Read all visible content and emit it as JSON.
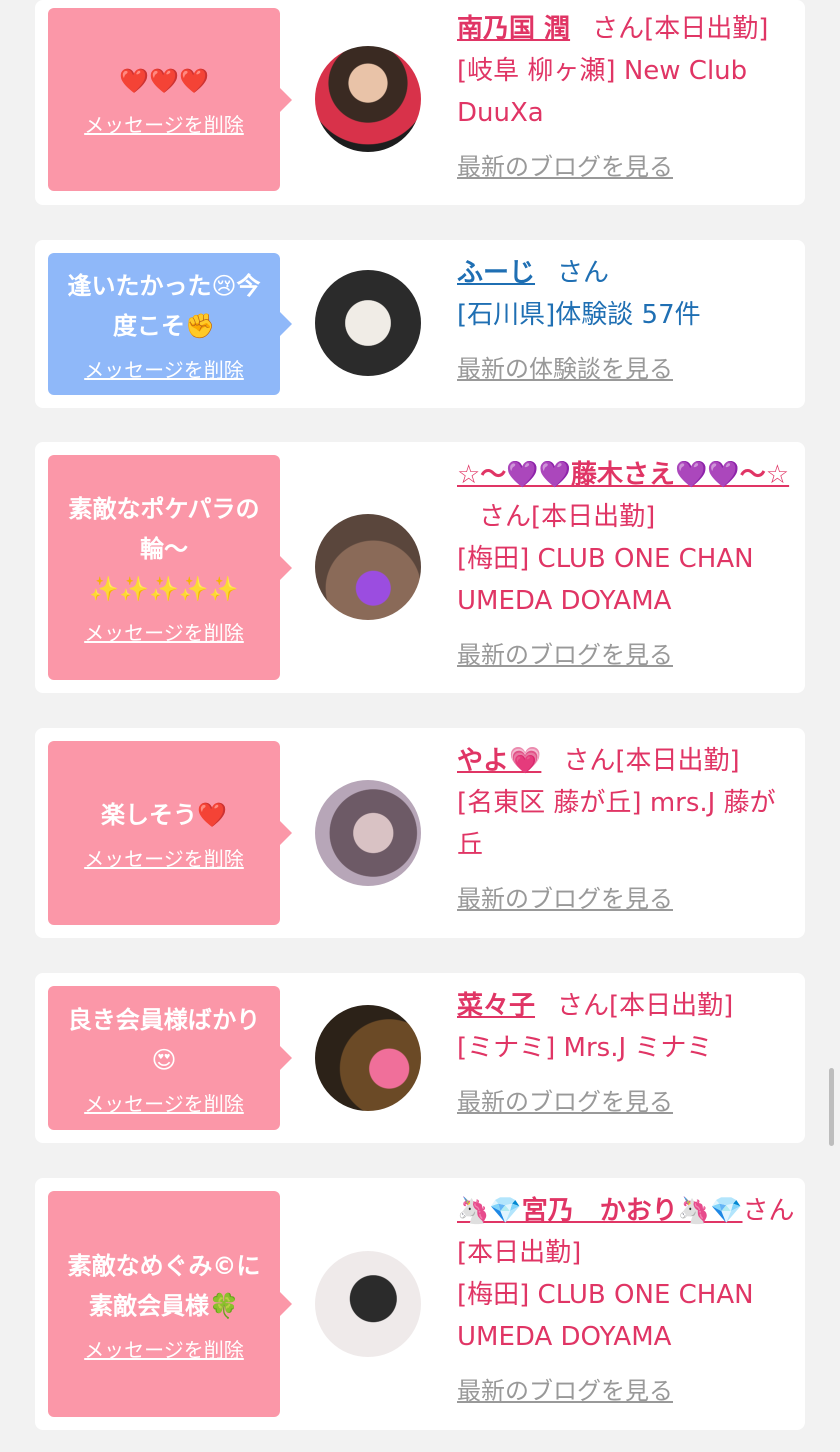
{
  "delete_label": "メッセージを削除",
  "san_label": "さん",
  "cards": [
    {
      "message": "❤️❤️❤️",
      "name": "南乃国 潤",
      "status": "[本日出勤]",
      "shop": "[岐阜 柳ヶ瀬] New Club DuuXa",
      "link": "最新のブログを見る"
    },
    {
      "message": "逢いたかった😢今度こそ✊",
      "name": "ふーじ",
      "status": "",
      "shop": "[石川県]体験談 57件",
      "link": "最新の体験談を見る"
    },
    {
      "message": "素敵なポケパラの輪〜\n✨✨✨✨✨",
      "name": "☆〜💜💜藤木さえ💜💜〜☆",
      "status": "[本日出勤]",
      "shop": "[梅田] CLUB ONE CHAN UMEDA DOYAMA",
      "link": "最新のブログを見る"
    },
    {
      "message": "楽しそう❤️",
      "name": "やよ💗",
      "status": "[本日出勤]",
      "shop": "[名東区 藤が丘] mrs.J 藤が丘",
      "link": "最新のブログを見る"
    },
    {
      "message": "良き会員様ばかり😍",
      "name": "菜々子",
      "status": "[本日出勤]",
      "shop": "[ミナミ] Mrs.J ミナミ",
      "link": "最新のブログを見る"
    },
    {
      "message": "素敵なめぐみ©に素敵会員様🍀",
      "name": "🦄💎宮乃　かおり🦄💎",
      "status": "[本日出勤]",
      "shop": "[梅田] CLUB ONE CHAN UMEDA DOYAMA",
      "link": "最新のブログを見る"
    }
  ],
  "colors": {
    "pink_bubble": "#fb97a8",
    "blue_bubble": "#8fb8f9",
    "pink_text": "#e03565",
    "blue_text": "#1f6fb3",
    "link_gray": "#999999",
    "background": "#f2f2f2"
  }
}
